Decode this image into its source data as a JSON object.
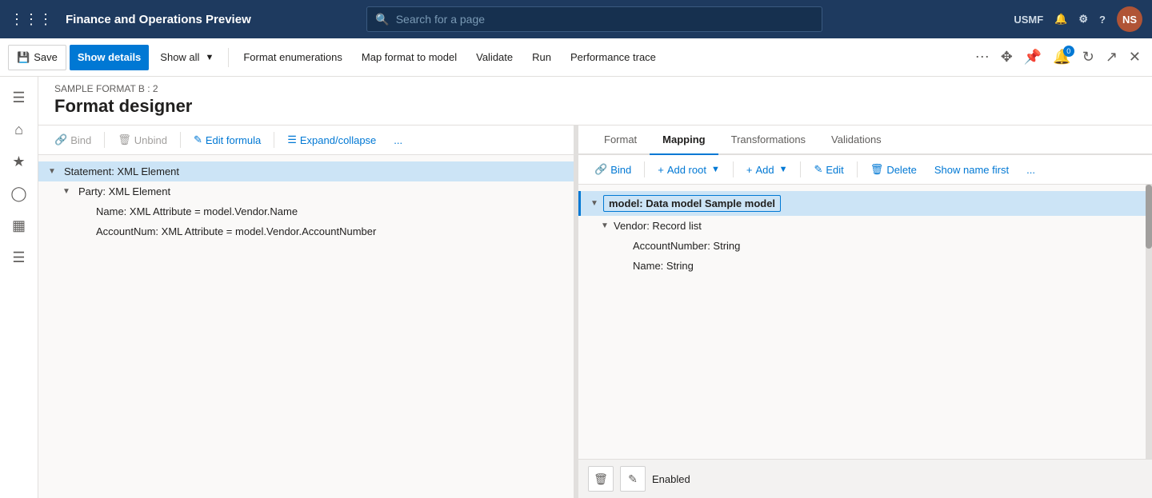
{
  "app": {
    "title": "Finance and Operations Preview",
    "search_placeholder": "Search for a page"
  },
  "topbar": {
    "user": "USMF",
    "avatar": "NS"
  },
  "toolbar": {
    "save_label": "Save",
    "show_details_label": "Show details",
    "show_all_label": "Show all",
    "format_enumerations_label": "Format enumerations",
    "map_format_label": "Map format to model",
    "validate_label": "Validate",
    "run_label": "Run",
    "performance_trace_label": "Performance trace"
  },
  "page": {
    "breadcrumb": "SAMPLE FORMAT B : 2",
    "title": "Format designer"
  },
  "left_panel": {
    "toolbar": {
      "bind_label": "Bind",
      "unbind_label": "Unbind",
      "edit_formula_label": "Edit formula",
      "expand_collapse_label": "Expand/collapse",
      "more_label": "..."
    },
    "tree": [
      {
        "id": "statement",
        "label": "Statement: XML Element",
        "level": 0,
        "has_arrow": true,
        "selected": true
      },
      {
        "id": "party",
        "label": "Party: XML Element",
        "level": 1,
        "has_arrow": true,
        "selected": false
      },
      {
        "id": "name",
        "label": "Name: XML Attribute = model.Vendor.Name",
        "level": 2,
        "has_arrow": false,
        "selected": false
      },
      {
        "id": "accountnum",
        "label": "AccountNum: XML Attribute = model.Vendor.AccountNumber",
        "level": 2,
        "has_arrow": false,
        "selected": false
      }
    ]
  },
  "right_panel": {
    "tabs": [
      {
        "id": "format",
        "label": "Format",
        "active": false
      },
      {
        "id": "mapping",
        "label": "Mapping",
        "active": true
      },
      {
        "id": "transformations",
        "label": "Transformations",
        "active": false
      },
      {
        "id": "validations",
        "label": "Validations",
        "active": false
      }
    ],
    "toolbar": {
      "bind_label": "Bind",
      "add_root_label": "Add root",
      "add_label": "Add",
      "edit_label": "Edit",
      "delete_label": "Delete",
      "show_name_first_label": "Show name first",
      "more_label": "..."
    },
    "tree": [
      {
        "id": "model",
        "label": "model: Data model Sample model",
        "level": 0,
        "has_arrow": true,
        "selected": true
      },
      {
        "id": "vendor",
        "label": "Vendor: Record list",
        "level": 1,
        "has_arrow": true,
        "selected": false
      },
      {
        "id": "accountnumber",
        "label": "AccountNumber: String",
        "level": 2,
        "has_arrow": false,
        "selected": false
      },
      {
        "id": "name",
        "label": "Name: String",
        "level": 2,
        "has_arrow": false,
        "selected": false
      }
    ],
    "bottom": {
      "enabled_label": "Enabled"
    }
  },
  "sidebar": {
    "items": [
      {
        "id": "menu",
        "icon": "☰",
        "label": "Menu"
      },
      {
        "id": "home",
        "icon": "⌂",
        "label": "Home"
      },
      {
        "id": "favorites",
        "icon": "★",
        "label": "Favorites"
      },
      {
        "id": "recent",
        "icon": "◷",
        "label": "Recent"
      },
      {
        "id": "workspaces",
        "icon": "▦",
        "label": "Workspaces"
      },
      {
        "id": "list",
        "icon": "☰",
        "label": "List"
      }
    ]
  }
}
